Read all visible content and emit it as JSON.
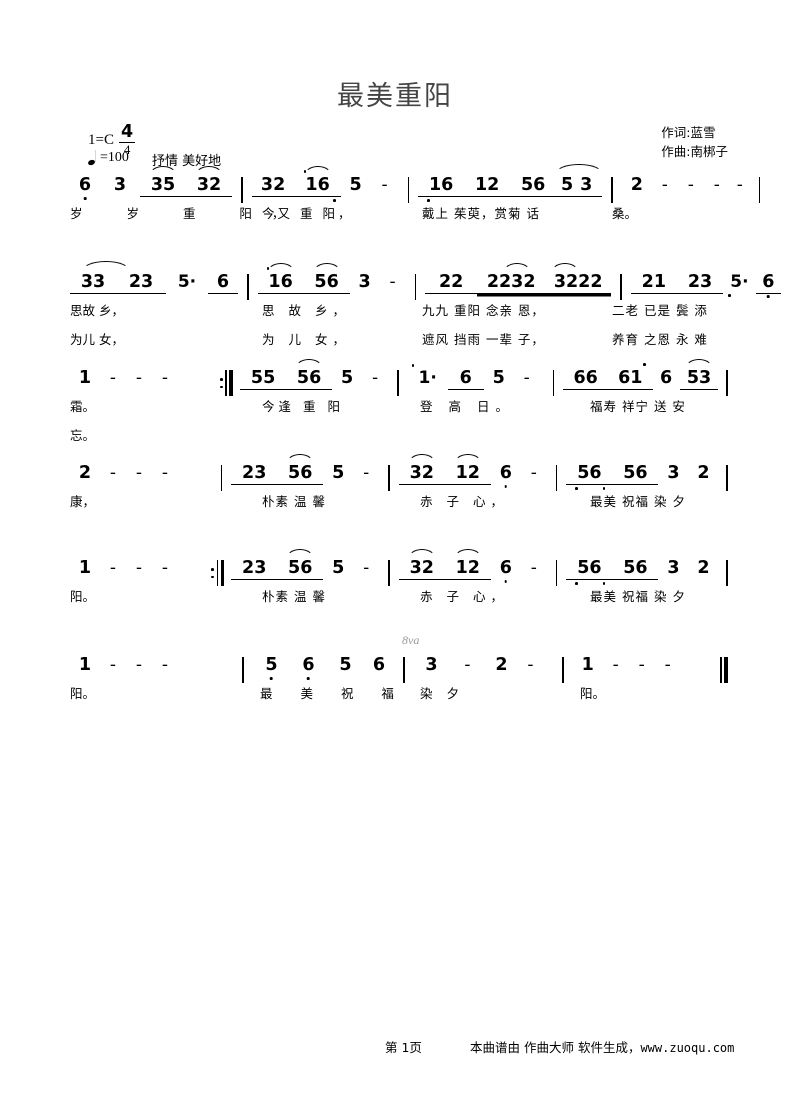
{
  "header": {
    "title": "最美重阳",
    "key_signature": "1=C",
    "time_signature_num": "4",
    "time_signature_den": "4",
    "tempo_mark": "=100",
    "expression": "抒情 美好地",
    "lyricist": "作词:蓝雪",
    "composer": "作曲:南梆子"
  },
  "footer": {
    "page": "第 1页",
    "source": "本曲谱由  作曲大师  软件生成，",
    "url": "www.zuoqu.com"
  },
  "ottava": "8va",
  "score": {
    "lines": [
      {
        "id": "line-1",
        "measures": [
          {
            "notes": [
              "6",
              "3",
              "35",
              "32"
            ],
            "lyrics": "岁  岁  重   阳，"
          },
          {
            "notes": [
              "32",
              "16",
              "5",
              "-"
            ],
            "lyrics": "今又 重   阳，"
          },
          {
            "notes": [
              "16",
              "12",
              "56",
              "53"
            ],
            "lyrics": "戴上 茱萸，赏菊 话"
          },
          {
            "notes": [
              "2",
              "-",
              "-",
              "-",
              "-"
            ],
            "lyrics": "桑。"
          }
        ]
      },
      {
        "id": "line-2",
        "measures": [
          {
            "notes": [
              "33",
              "23",
              "5·",
              "6"
            ],
            "lyrics": "思故   乡，",
            "lyrics2": "为儿   女，"
          },
          {
            "notes": [
              "16",
              "56",
              "3",
              "-"
            ],
            "lyrics": "思  故  乡，",
            "lyrics2": "为  儿  女，"
          },
          {
            "notes": [
              "22",
              "2232",
              "3222"
            ],
            "lyrics": "九九 重阳 念亲  恩，",
            "lyrics2": "遮风 挡雨 一辈  子，"
          },
          {
            "notes": [
              "21",
              "23",
              "5·",
              "6"
            ],
            "lyrics": "二老 已是 鬓 添",
            "lyrics2": "养育 之恩 永 难"
          }
        ]
      },
      {
        "id": "line-3",
        "measures": [
          {
            "notes": [
              "1",
              "-",
              "-",
              "-"
            ],
            "lyrics": "霜。",
            "lyrics2": "忘。"
          },
          {
            "notes": [
              "55",
              "56",
              "5",
              "-"
            ],
            "lyrics": "今逢 重   阳",
            "repeat_start": true
          },
          {
            "notes": [
              "1·",
              "6",
              "5",
              "-"
            ],
            "lyrics": "登  高  日。"
          },
          {
            "notes": [
              "66",
              "61",
              "6",
              "53"
            ],
            "lyrics": "福寿 祥宁 送 安"
          }
        ]
      },
      {
        "id": "line-4",
        "measures": [
          {
            "notes": [
              "2",
              "-",
              "-",
              "-"
            ],
            "lyrics": "康，"
          },
          {
            "notes": [
              "23",
              "56",
              "5",
              "-"
            ],
            "lyrics": "朴素 温   馨"
          },
          {
            "notes": [
              "32",
              "12",
              "6",
              "-"
            ],
            "lyrics": "赤  子  心，"
          },
          {
            "notes": [
              "56",
              "56",
              "3",
              "2"
            ],
            "lyrics": "最美 祝福 染 夕"
          }
        ]
      },
      {
        "id": "line-5",
        "measures": [
          {
            "notes": [
              "1",
              "-",
              "-",
              "-"
            ],
            "lyrics": "阳。"
          },
          {
            "notes": [
              "23",
              "56",
              "5",
              "-"
            ],
            "lyrics": "朴素 温   馨",
            "repeat_start": true
          },
          {
            "notes": [
              "32",
              "12",
              "6",
              "-"
            ],
            "lyrics": "赤  子  心，"
          },
          {
            "notes": [
              "56",
              "56",
              "3",
              "2"
            ],
            "lyrics": "最美 祝福 染 夕"
          }
        ]
      },
      {
        "id": "line-6",
        "measures": [
          {
            "notes": [
              "1",
              "-",
              "-",
              "-"
            ],
            "lyrics": "阳。"
          },
          {
            "notes": [
              "5",
              "6",
              "5",
              "6"
            ],
            "lyrics": "最  美  祝  福"
          },
          {
            "notes": [
              "3",
              "-",
              "2",
              "-"
            ],
            "lyrics": "染    夕"
          },
          {
            "notes": [
              "1",
              "-",
              "-",
              "-"
            ],
            "lyrics": "阳。"
          }
        ]
      }
    ]
  }
}
